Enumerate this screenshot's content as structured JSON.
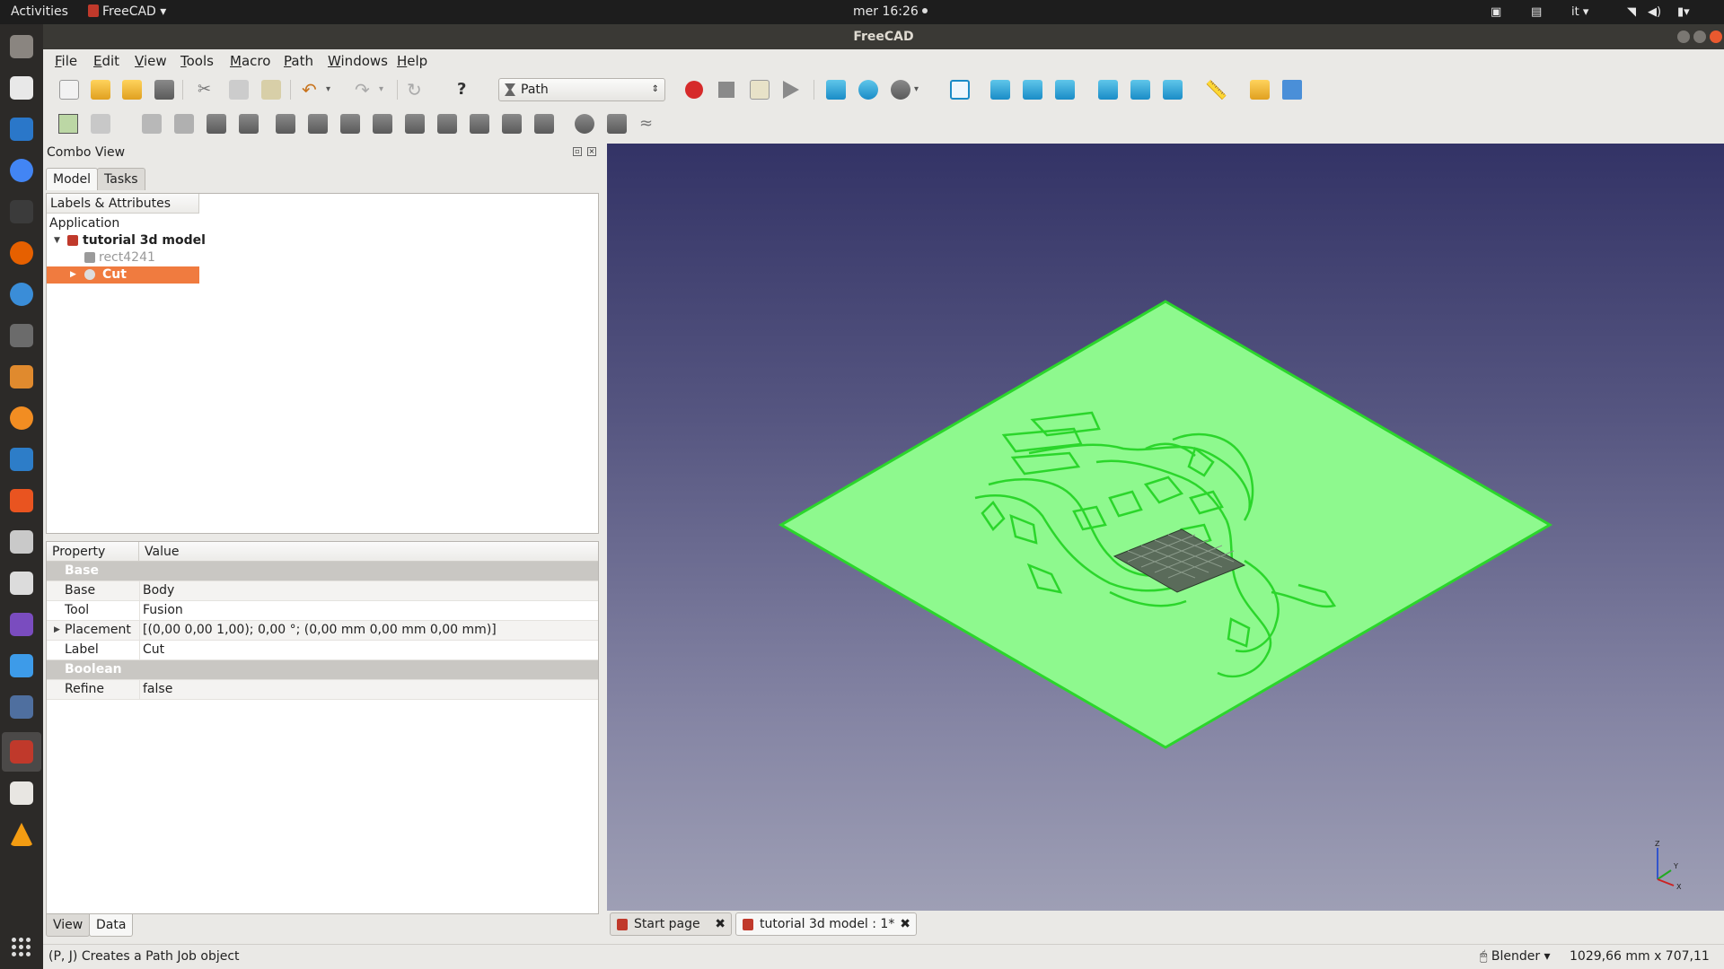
{
  "topbar": {
    "activities": "Activities",
    "app_name": "FreeCAD",
    "clock": "mer 16:26",
    "lang": "it"
  },
  "window": {
    "title": "FreeCAD"
  },
  "menu": [
    "File",
    "Edit",
    "View",
    "Tools",
    "Macro",
    "Path",
    "Windows",
    "Help"
  ],
  "toolbar": {
    "workbench": "Path"
  },
  "combo": {
    "title": "Combo View",
    "tabs": [
      "Model",
      "Tasks"
    ],
    "tree_header": "Labels & Attributes",
    "tree": {
      "root": "Application",
      "document": "tutorial 3d model",
      "items": [
        "rect4241",
        "Cut"
      ]
    },
    "properties": {
      "header_property": "Property",
      "header_value": "Value",
      "groups": [
        {
          "name": "Base",
          "rows": [
            {
              "name": "Base",
              "value": "Body"
            },
            {
              "name": "Tool",
              "value": "Fusion"
            },
            {
              "name": "Placement",
              "value": "[(0,00 0,00 1,00); 0,00 °; (0,00 mm  0,00 mm  0,00 mm)]"
            },
            {
              "name": "Label",
              "value": "Cut"
            }
          ]
        },
        {
          "name": "Boolean",
          "rows": [
            {
              "name": "Refine",
              "value": "false"
            }
          ]
        }
      ]
    },
    "bottom_tabs": [
      "View",
      "Data"
    ]
  },
  "doc_tabs": [
    "Start page",
    "tutorial 3d model : 1*"
  ],
  "status": {
    "message": "(P, J) Creates a Path Job object",
    "nav_style": "Blender",
    "dimensions": "1029,66 mm x 707,11 mm"
  },
  "axes": {
    "z": "Z",
    "y": "Y",
    "x": "X"
  },
  "colors": {
    "model_fill": "#8ef98e",
    "model_edge": "#2bd62b",
    "selection": "#f07b3f"
  }
}
